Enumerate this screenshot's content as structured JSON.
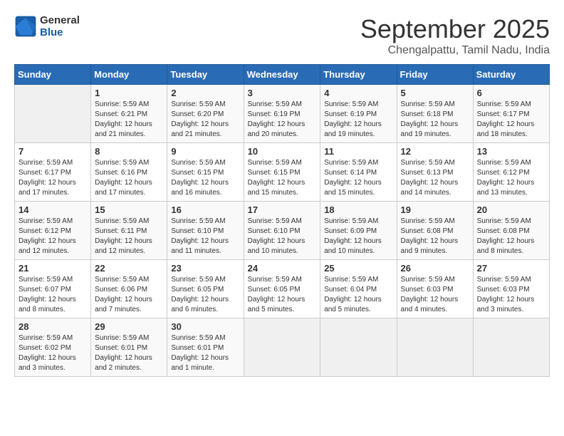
{
  "logo": {
    "line1": "General",
    "line2": "Blue"
  },
  "title": "September 2025",
  "subtitle": "Chengalpattu, Tamil Nadu, India",
  "weekdays": [
    "Sunday",
    "Monday",
    "Tuesday",
    "Wednesday",
    "Thursday",
    "Friday",
    "Saturday"
  ],
  "weeks": [
    [
      {
        "day": "",
        "info": ""
      },
      {
        "day": "1",
        "info": "Sunrise: 5:59 AM\nSunset: 6:21 PM\nDaylight: 12 hours\nand 21 minutes."
      },
      {
        "day": "2",
        "info": "Sunrise: 5:59 AM\nSunset: 6:20 PM\nDaylight: 12 hours\nand 21 minutes."
      },
      {
        "day": "3",
        "info": "Sunrise: 5:59 AM\nSunset: 6:19 PM\nDaylight: 12 hours\nand 20 minutes."
      },
      {
        "day": "4",
        "info": "Sunrise: 5:59 AM\nSunset: 6:19 PM\nDaylight: 12 hours\nand 19 minutes."
      },
      {
        "day": "5",
        "info": "Sunrise: 5:59 AM\nSunset: 6:18 PM\nDaylight: 12 hours\nand 19 minutes."
      },
      {
        "day": "6",
        "info": "Sunrise: 5:59 AM\nSunset: 6:17 PM\nDaylight: 12 hours\nand 18 minutes."
      }
    ],
    [
      {
        "day": "7",
        "info": "Sunrise: 5:59 AM\nSunset: 6:17 PM\nDaylight: 12 hours\nand 17 minutes."
      },
      {
        "day": "8",
        "info": "Sunrise: 5:59 AM\nSunset: 6:16 PM\nDaylight: 12 hours\nand 17 minutes."
      },
      {
        "day": "9",
        "info": "Sunrise: 5:59 AM\nSunset: 6:15 PM\nDaylight: 12 hours\nand 16 minutes."
      },
      {
        "day": "10",
        "info": "Sunrise: 5:59 AM\nSunset: 6:15 PM\nDaylight: 12 hours\nand 15 minutes."
      },
      {
        "day": "11",
        "info": "Sunrise: 5:59 AM\nSunset: 6:14 PM\nDaylight: 12 hours\nand 15 minutes."
      },
      {
        "day": "12",
        "info": "Sunrise: 5:59 AM\nSunset: 6:13 PM\nDaylight: 12 hours\nand 14 minutes."
      },
      {
        "day": "13",
        "info": "Sunrise: 5:59 AM\nSunset: 6:12 PM\nDaylight: 12 hours\nand 13 minutes."
      }
    ],
    [
      {
        "day": "14",
        "info": "Sunrise: 5:59 AM\nSunset: 6:12 PM\nDaylight: 12 hours\nand 12 minutes."
      },
      {
        "day": "15",
        "info": "Sunrise: 5:59 AM\nSunset: 6:11 PM\nDaylight: 12 hours\nand 12 minutes."
      },
      {
        "day": "16",
        "info": "Sunrise: 5:59 AM\nSunset: 6:10 PM\nDaylight: 12 hours\nand 11 minutes."
      },
      {
        "day": "17",
        "info": "Sunrise: 5:59 AM\nSunset: 6:10 PM\nDaylight: 12 hours\nand 10 minutes."
      },
      {
        "day": "18",
        "info": "Sunrise: 5:59 AM\nSunset: 6:09 PM\nDaylight: 12 hours\nand 10 minutes."
      },
      {
        "day": "19",
        "info": "Sunrise: 5:59 AM\nSunset: 6:08 PM\nDaylight: 12 hours\nand 9 minutes."
      },
      {
        "day": "20",
        "info": "Sunrise: 5:59 AM\nSunset: 6:08 PM\nDaylight: 12 hours\nand 8 minutes."
      }
    ],
    [
      {
        "day": "21",
        "info": "Sunrise: 5:59 AM\nSunset: 6:07 PM\nDaylight: 12 hours\nand 8 minutes."
      },
      {
        "day": "22",
        "info": "Sunrise: 5:59 AM\nSunset: 6:06 PM\nDaylight: 12 hours\nand 7 minutes."
      },
      {
        "day": "23",
        "info": "Sunrise: 5:59 AM\nSunset: 6:05 PM\nDaylight: 12 hours\nand 6 minutes."
      },
      {
        "day": "24",
        "info": "Sunrise: 5:59 AM\nSunset: 6:05 PM\nDaylight: 12 hours\nand 5 minutes."
      },
      {
        "day": "25",
        "info": "Sunrise: 5:59 AM\nSunset: 6:04 PM\nDaylight: 12 hours\nand 5 minutes."
      },
      {
        "day": "26",
        "info": "Sunrise: 5:59 AM\nSunset: 6:03 PM\nDaylight: 12 hours\nand 4 minutes."
      },
      {
        "day": "27",
        "info": "Sunrise: 5:59 AM\nSunset: 6:03 PM\nDaylight: 12 hours\nand 3 minutes."
      }
    ],
    [
      {
        "day": "28",
        "info": "Sunrise: 5:59 AM\nSunset: 6:02 PM\nDaylight: 12 hours\nand 3 minutes."
      },
      {
        "day": "29",
        "info": "Sunrise: 5:59 AM\nSunset: 6:01 PM\nDaylight: 12 hours\nand 2 minutes."
      },
      {
        "day": "30",
        "info": "Sunrise: 5:59 AM\nSunset: 6:01 PM\nDaylight: 12 hours\nand 1 minute."
      },
      {
        "day": "",
        "info": ""
      },
      {
        "day": "",
        "info": ""
      },
      {
        "day": "",
        "info": ""
      },
      {
        "day": "",
        "info": ""
      }
    ]
  ]
}
